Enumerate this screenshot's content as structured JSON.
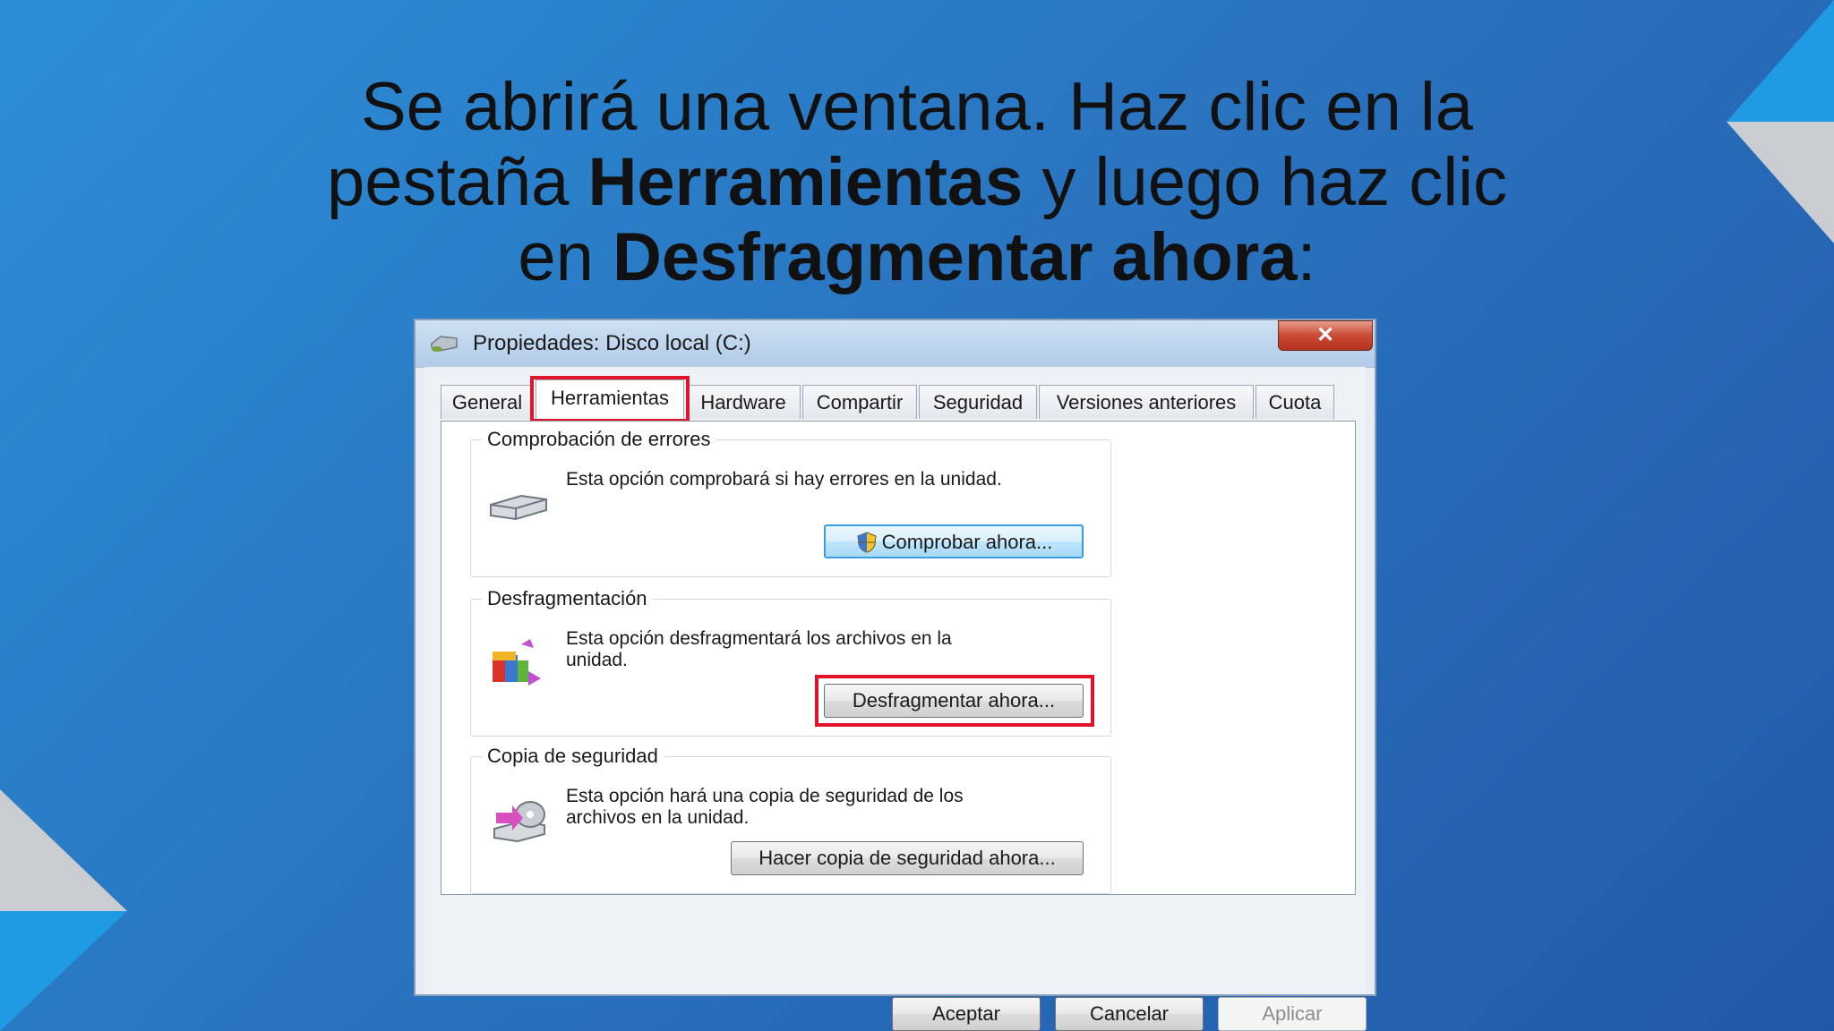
{
  "slide": {
    "line1": "Se abrirá una ventana. Haz clic en la",
    "line2_pre": "pestaña ",
    "line2_bold": "Herramientas",
    "line2_post": " y luego haz clic",
    "line3_pre": "en ",
    "line3_bold": "Desfragmentar ahora",
    "line3_post": ":"
  },
  "window": {
    "title": "Propiedades: Disco local (C:)",
    "close_label": "✕"
  },
  "tabs": [
    {
      "label": "General"
    },
    {
      "label": "Herramientas"
    },
    {
      "label": "Hardware"
    },
    {
      "label": "Compartir"
    },
    {
      "label": "Seguridad"
    },
    {
      "label": "Versiones anteriores"
    },
    {
      "label": "Cuota"
    }
  ],
  "groups": {
    "check": {
      "title": "Comprobación de errores",
      "desc": "Esta opción comprobará si hay errores en la unidad.",
      "button": "Comprobar ahora..."
    },
    "defrag": {
      "title": "Desfragmentación",
      "desc": "Esta opción desfragmentará los archivos en la unidad.",
      "button": "Desfragmentar ahora..."
    },
    "backup": {
      "title": "Copia de seguridad",
      "desc": "Esta opción hará una copia de seguridad de los archivos en la unidad.",
      "button": "Hacer copia de seguridad ahora..."
    }
  },
  "footer": {
    "ok": "Aceptar",
    "cancel": "Cancelar",
    "apply": "Aplicar"
  },
  "colors": {
    "highlight": "#e0142a",
    "background": "#2a74c0"
  }
}
